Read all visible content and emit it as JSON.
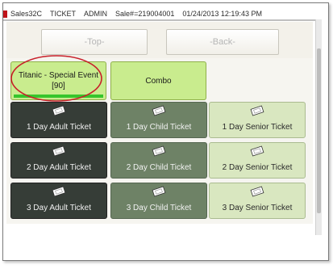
{
  "status": {
    "app": "Sales32C",
    "module": "TICKET",
    "user": "ADMIN",
    "sale": "Sale#=219004001",
    "datetime": "01/24/2013 12:19:43 PM"
  },
  "nav": {
    "top_label": "-Top-",
    "back_label": "-Back-"
  },
  "event": {
    "title": "Titanic - Special Event",
    "count": "[90]",
    "progress": 1.0
  },
  "combo": {
    "label": "Combo"
  },
  "tickets": [
    {
      "label": "1 Day Adult Ticket",
      "type": "adult"
    },
    {
      "label": "1 Day Child Ticket",
      "type": "child"
    },
    {
      "label": "1 Day Senior Ticket",
      "type": "senior"
    },
    {
      "label": "2 Day Adult Ticket",
      "type": "adult"
    },
    {
      "label": "2 Day Child Ticket",
      "type": "child"
    },
    {
      "label": "2 Day Senior Ticket",
      "type": "senior"
    },
    {
      "label": "3 Day Adult Ticket",
      "type": "adult"
    },
    {
      "label": "3 Day Child Ticket",
      "type": "child"
    },
    {
      "label": "3 Day Senior Ticket",
      "type": "senior"
    }
  ],
  "colors": {
    "event_green": "#c9ec8e",
    "adult": "#363d37",
    "child": "#6e8266",
    "senior": "#d9e7c0",
    "highlight_circle": "#c8202a"
  },
  "icons": {
    "ticket": "ticket-icon"
  }
}
